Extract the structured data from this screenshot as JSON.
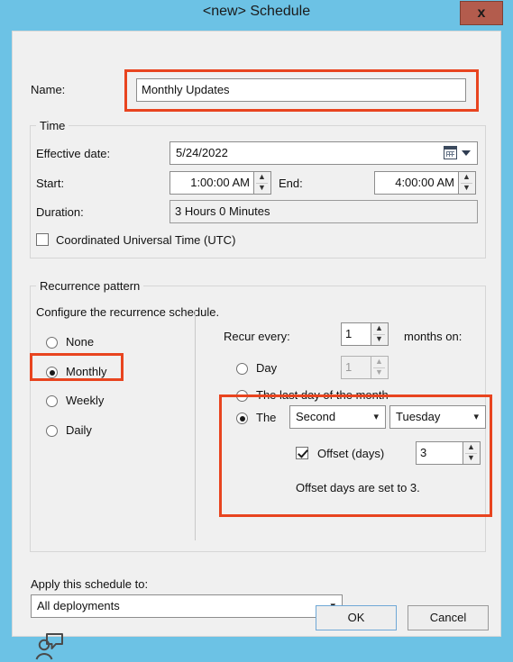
{
  "window": {
    "title": "<new> Schedule",
    "close_label": "x",
    "titlebar_color": "#6cc2e5",
    "close_button_color": "#b35c4d",
    "highlight_color": "#e8441f"
  },
  "name_field": {
    "label": "Name:",
    "value": "Monthly Updates",
    "highlighted": true
  },
  "time_group": {
    "legend": "Time",
    "effective_date": {
      "label": "Effective date:",
      "value": "5/24/2022",
      "icon": "calendar-icon"
    },
    "start": {
      "label": "Start:",
      "value": "1:00:00 AM"
    },
    "end": {
      "label": "End:",
      "value": "4:00:00 AM"
    },
    "duration": {
      "label": "Duration:",
      "value": "3 Hours 0 Minutes"
    },
    "utc": {
      "label": "Coordinated Universal Time (UTC)",
      "checked": false
    }
  },
  "recurrence_group": {
    "legend": "Recurrence pattern",
    "description": "Configure the recurrence schedule.",
    "pattern_options": [
      {
        "label": "None",
        "selected": false
      },
      {
        "label": "Monthly",
        "selected": true,
        "highlighted": true
      },
      {
        "label": "Weekly",
        "selected": false
      },
      {
        "label": "Daily",
        "selected": false
      }
    ],
    "recur_every": {
      "label": "Recur every:",
      "value": "1",
      "suffix": "months on:"
    },
    "day_option": {
      "label": "Day",
      "selected": false,
      "value": "1",
      "disabled": true
    },
    "last_day_option": {
      "label": "The last day of the month",
      "selected": false
    },
    "the_option": {
      "label": "The",
      "selected": true,
      "ordinal": "Second",
      "weekday": "Tuesday",
      "offset": {
        "label": "Offset (days)",
        "checked": true,
        "value": "3"
      },
      "note": "Offset days are set to 3."
    }
  },
  "apply_to": {
    "label": "Apply this schedule to:",
    "value": "All deployments"
  },
  "footer": {
    "user_icon": "user-comment-icon",
    "ok_label": "OK",
    "cancel_label": "Cancel"
  }
}
